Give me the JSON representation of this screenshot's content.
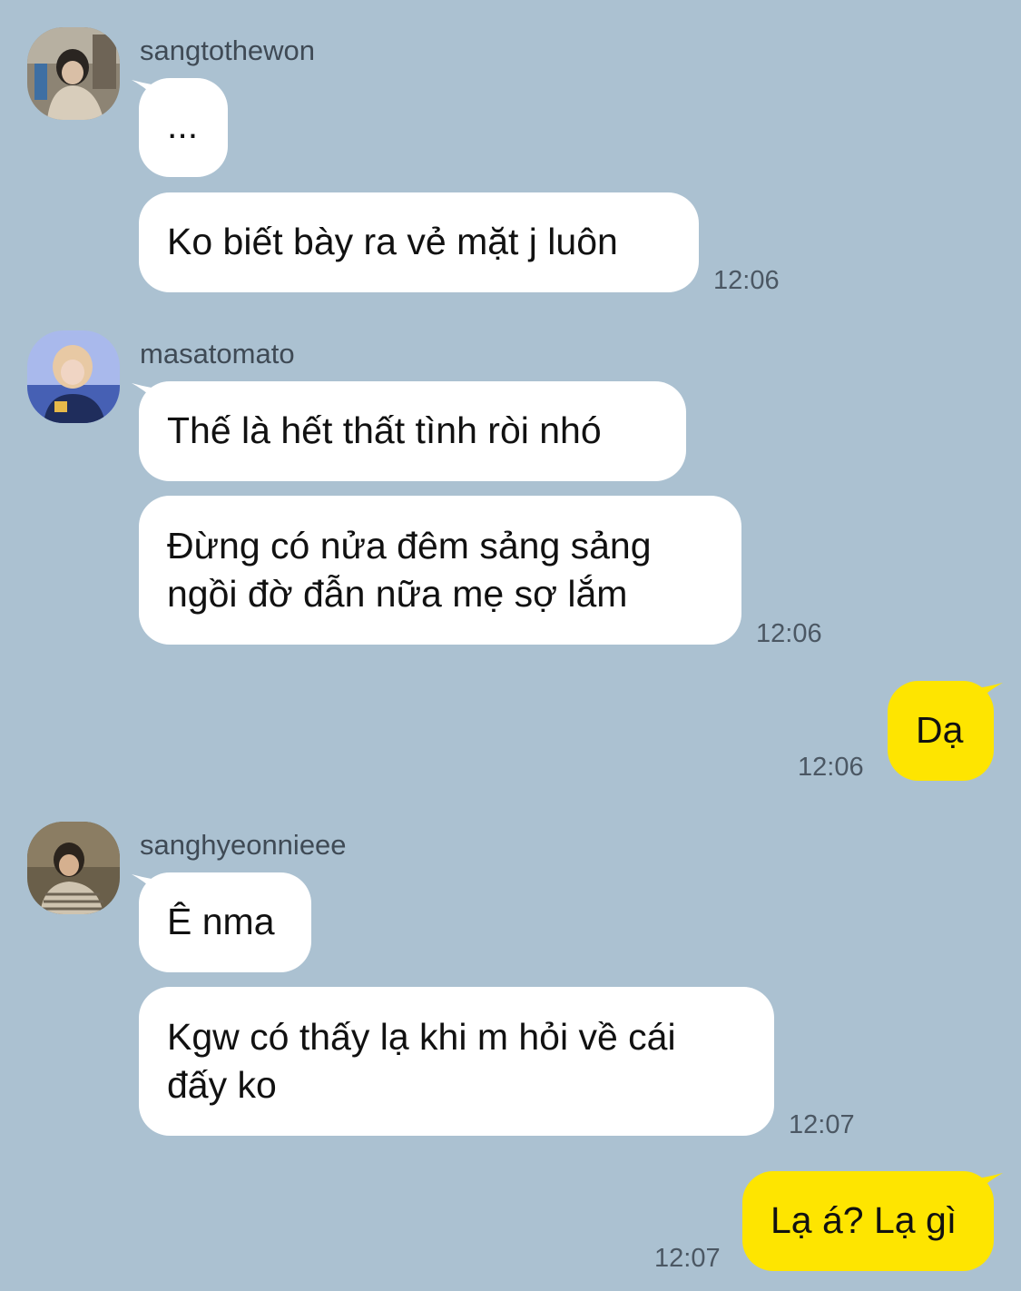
{
  "colors": {
    "background": "#abc1d1",
    "incoming_bubble": "#ffffff",
    "outgoing_bubble": "#fee500"
  },
  "groups": [
    {
      "sender": "sangtothewon",
      "avatar": "profile-photo",
      "messages": [
        "...",
        "Ko biết bày ra vẻ mặt j luôn"
      ],
      "time": "12:06"
    },
    {
      "sender": "masatomato",
      "avatar": "profile-photo",
      "messages": [
        "Thế là hết thất tình ròi nhó",
        [
          "Đừng có nửa đêm sảng sảng",
          "ngồi đờ đẫn nữa mẹ sợ lắm"
        ]
      ],
      "time": "12:06"
    },
    {
      "sender": "me",
      "messages": [
        "Dạ"
      ],
      "time": "12:06"
    },
    {
      "sender": "sanghyeonnieee",
      "avatar": "profile-photo",
      "messages": [
        "Ê nma",
        [
          "Kgw có thấy lạ khi m hỏi về cái",
          "đấy ko"
        ]
      ],
      "time": "12:07"
    },
    {
      "sender": "me",
      "messages": [
        "Lạ á? Lạ gì"
      ],
      "time": "12:07"
    }
  ]
}
